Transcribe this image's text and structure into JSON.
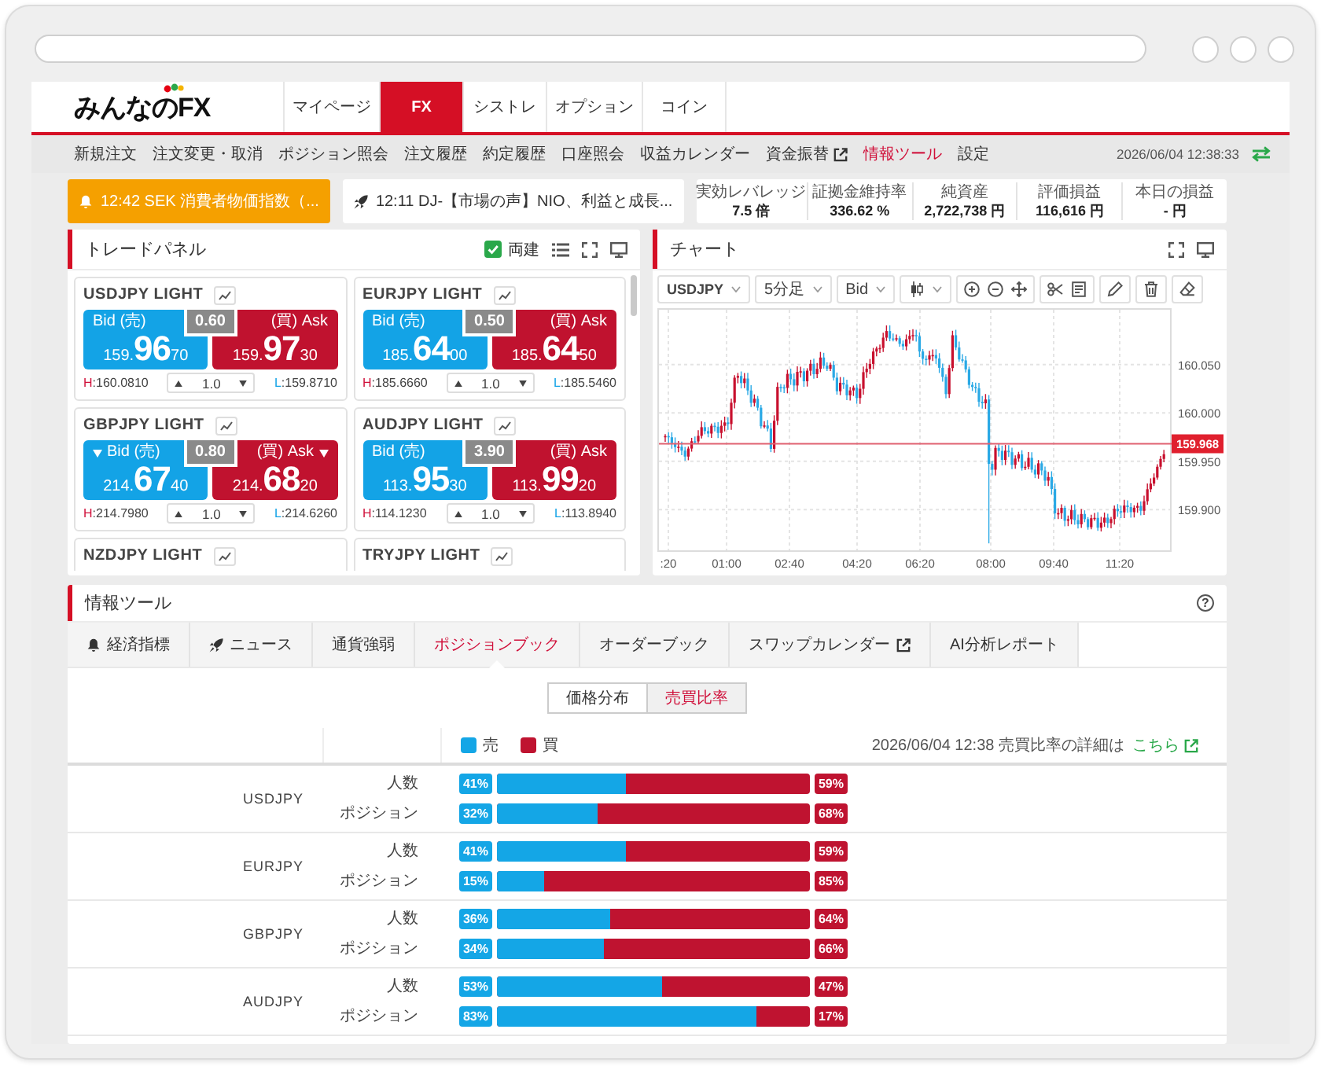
{
  "header": {
    "logo": "みんなのFX",
    "tabs": [
      {
        "label": "マイページ",
        "selected": false
      },
      {
        "label": "FX",
        "selected": true
      },
      {
        "label": "シストレ",
        "selected": false
      },
      {
        "label": "オプション",
        "selected": false
      },
      {
        "label": "コイン",
        "selected": false
      }
    ]
  },
  "menu": {
    "items": [
      {
        "label": "新規注文",
        "kind": "page",
        "selected": false
      },
      {
        "label": "注文変更・取消",
        "kind": "page",
        "selected": false
      },
      {
        "label": "ポジション照会",
        "kind": "page",
        "selected": false
      },
      {
        "label": "注文履歴",
        "kind": "page",
        "selected": false
      },
      {
        "label": "約定履歴",
        "kind": "page",
        "selected": false
      },
      {
        "label": "口座照会",
        "kind": "page",
        "selected": false
      },
      {
        "label": "収益カレンダー",
        "kind": "page",
        "selected": false
      },
      {
        "label": "資金振替",
        "kind": "external",
        "selected": false
      },
      {
        "label": "情報ツール",
        "kind": "page",
        "selected": true
      },
      {
        "label": "設定",
        "kind": "page",
        "selected": false
      }
    ],
    "datetime": "2026/06/04 12:38:33"
  },
  "ticker": {
    "alert": "12:42 SEK 消費者物価指数（...",
    "news": "12:11 DJ-【市場の声】NIO、利益と成長...",
    "stats": [
      {
        "label": "実効レバレッジ",
        "value": "7.5 倍"
      },
      {
        "label": "証拠金維持率",
        "value": "336.62 %"
      },
      {
        "label": "純資産",
        "value": "2,722,738 円"
      },
      {
        "label": "評価損益",
        "value": "116,616 円"
      },
      {
        "label": "本日の損益",
        "value": "- 円"
      }
    ]
  },
  "trade_panel": {
    "title": "トレードパネル",
    "hedge": {
      "label": "両建",
      "checked": true
    },
    "cards": [
      {
        "pair": "USDJPY LIGHT",
        "down_tick": false,
        "bid_label": "Bid (売)",
        "ask_label": "(買) Ask",
        "spread": "0.60",
        "bid": [
          "159.",
          "96",
          "70"
        ],
        "ask": [
          "159.",
          "97",
          "30"
        ],
        "high": [
          "H",
          ":160.0810"
        ],
        "low": [
          "L",
          ":159.8710"
        ],
        "quantity": "1.0"
      },
      {
        "pair": "EURJPY LIGHT",
        "down_tick": false,
        "bid_label": "Bid (売)",
        "ask_label": "(買) Ask",
        "spread": "0.50",
        "bid": [
          "185.",
          "64",
          "00"
        ],
        "ask": [
          "185.",
          "64",
          "50"
        ],
        "high": [
          "H",
          ":185.6660"
        ],
        "low": [
          "L",
          ":185.5460"
        ],
        "quantity": "1.0"
      },
      {
        "pair": "GBPJPY LIGHT",
        "down_tick": true,
        "bid_label": "Bid (売)",
        "ask_label": "(買) Ask",
        "spread": "0.80",
        "bid": [
          "214.",
          "67",
          "40"
        ],
        "ask": [
          "214.",
          "68",
          "20"
        ],
        "high": [
          "H",
          ":214.7980"
        ],
        "low": [
          "L",
          ":214.6260"
        ],
        "quantity": "1.0"
      },
      {
        "pair": "AUDJPY LIGHT",
        "down_tick": false,
        "bid_label": "Bid (売)",
        "ask_label": "(買) Ask",
        "spread": "3.90",
        "bid": [
          "113.",
          "95",
          "30"
        ],
        "ask": [
          "113.",
          "99",
          "20"
        ],
        "high": [
          "H",
          ":114.1230"
        ],
        "low": [
          "L",
          ":113.8940"
        ],
        "quantity": "1.0"
      },
      {
        "pair": "NZDJPY LIGHT"
      },
      {
        "pair": "TRYJPY LIGHT"
      }
    ]
  },
  "chart_panel": {
    "title": "チャート",
    "toolbar": {
      "symbol": "USDJPY",
      "interval": "5分足",
      "side": "Bid"
    },
    "y_labels": [
      "160.050",
      "160.000",
      "159.950",
      "159.900"
    ],
    "x_labels": [
      ":20",
      "01:00",
      "02:40",
      "04:20",
      "06:20",
      "08:00",
      "09:40",
      "11:20"
    ],
    "price_label": "159.968"
  },
  "info_tools": {
    "title": "情報ツール",
    "help": "?",
    "tabs": [
      {
        "label": "経済指標",
        "kind": "indicator",
        "selected": false
      },
      {
        "label": "ニュース",
        "kind": "news",
        "selected": false
      },
      {
        "label": "通貨強弱",
        "kind": "plain",
        "selected": false
      },
      {
        "label": "ポジションブック",
        "kind": "plain",
        "selected": true
      },
      {
        "label": "オーダーブック",
        "kind": "plain",
        "selected": false
      },
      {
        "label": "スワップカレンダー",
        "kind": "external",
        "selected": false
      },
      {
        "label": "AI分析レポート",
        "kind": "plain",
        "selected": false
      }
    ],
    "views": [
      {
        "label": "価格分布",
        "selected": false
      },
      {
        "label": "売買比率",
        "selected": true
      }
    ],
    "legend": [
      {
        "label": "売",
        "color": "#14a6e6"
      },
      {
        "label": "買",
        "color": "#bf1330"
      }
    ],
    "updated": "2026/06/04 12:38 売買比率の詳細は",
    "link": "こちら",
    "rows": [
      {
        "pair": "USDJPY",
        "bars": [
          {
            "label": "人数",
            "level": 0.41,
            "sell": "41%",
            "buy": "59%"
          },
          {
            "label": "ポジション",
            "level": 0.32,
            "sell": "32%",
            "buy": "68%"
          }
        ]
      },
      {
        "pair": "EURJPY",
        "bars": [
          {
            "label": "人数",
            "level": 0.41,
            "sell": "41%",
            "buy": "59%"
          },
          {
            "label": "ポジション",
            "level": 0.15,
            "sell": "15%",
            "buy": "85%"
          }
        ]
      },
      {
        "pair": "GBPJPY",
        "bars": [
          {
            "label": "人数",
            "level": 0.36,
            "sell": "36%",
            "buy": "64%"
          },
          {
            "label": "ポジション",
            "level": 0.34,
            "sell": "34%",
            "buy": "66%"
          }
        ]
      },
      {
        "pair": "AUDJPY",
        "bars": [
          {
            "label": "人数",
            "level": 0.53,
            "sell": "53%",
            "buy": "47%"
          },
          {
            "label": "ポジション",
            "level": 0.83,
            "sell": "83%",
            "buy": "17%"
          }
        ]
      }
    ]
  }
}
